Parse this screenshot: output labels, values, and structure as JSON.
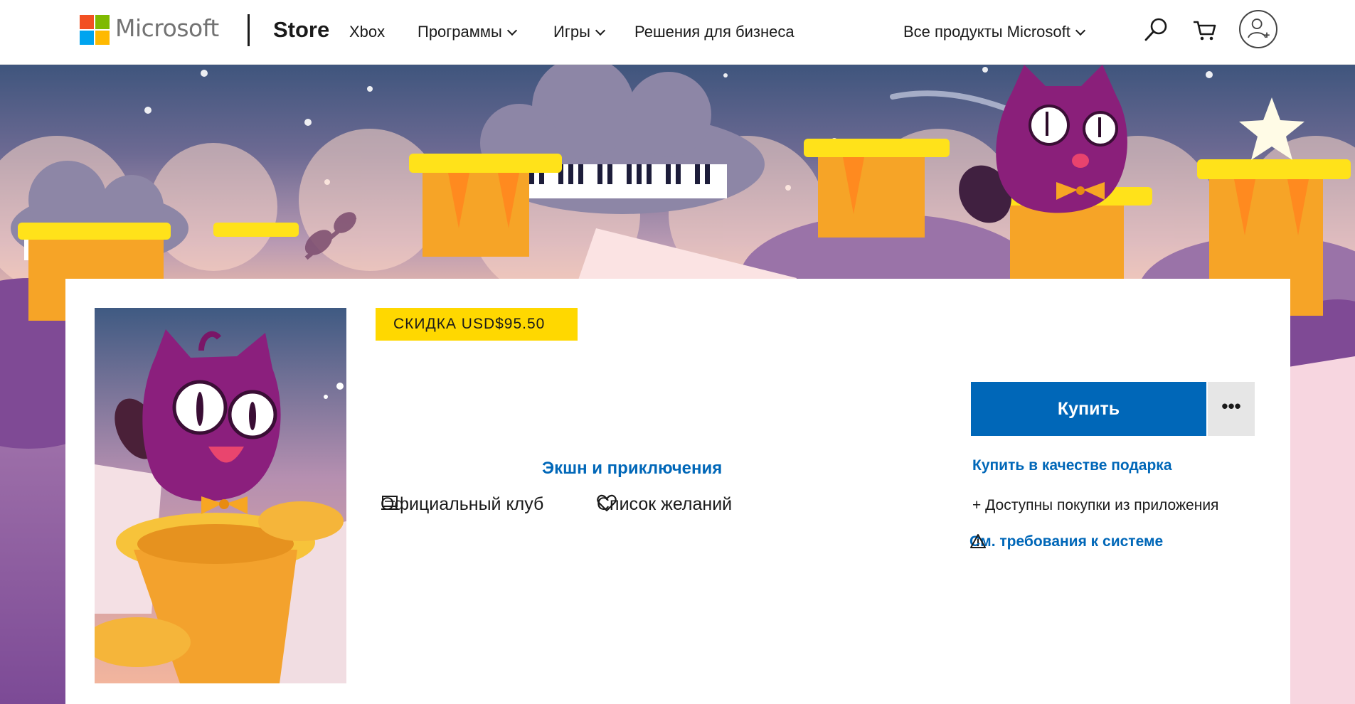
{
  "brand": {
    "company": "Microsoft",
    "store": "Store",
    "logo_colors": [
      "#f25022",
      "#7fba00",
      "#00a4ef",
      "#ffb900"
    ]
  },
  "nav": {
    "items": [
      {
        "label": "Xbox",
        "dropdown": false
      },
      {
        "label": "Программы",
        "dropdown": true
      },
      {
        "label": "Игры",
        "dropdown": true
      },
      {
        "label": "Решения для бизнеса",
        "dropdown": false
      }
    ],
    "all_products": "Все продукты Microsoft",
    "icons": [
      "search-icon",
      "cart-icon",
      "account-icon"
    ]
  },
  "product": {
    "badge": "СКИДКА USD$95.50",
    "genre": "Экшн и приключения",
    "club_label": "Официальный клуб",
    "wishlist_label": "Список желаний",
    "buy_label": "Купить",
    "more_label": "•••",
    "gift_label": "Купить в качестве подарка",
    "iap_label": "+ Доступны покупки из приложения",
    "sysreq_label": "См. требования к системе"
  },
  "colors": {
    "accent": "#0067b8",
    "badge": "#ffd800"
  }
}
